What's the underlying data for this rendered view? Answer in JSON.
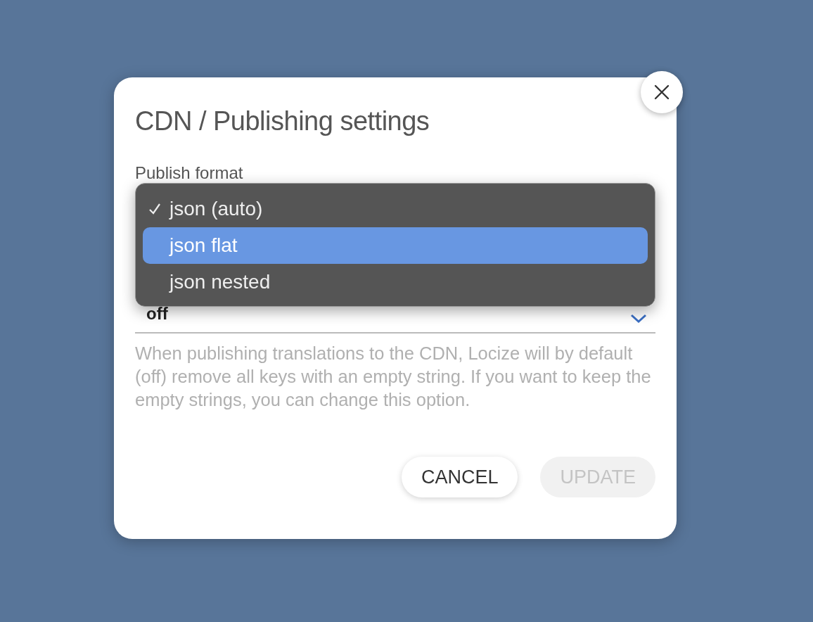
{
  "dialog": {
    "title": "CDN / Publishing settings",
    "publish_format": {
      "label": "Publish format",
      "menu": [
        {
          "label": "json (auto)",
          "checked": true,
          "selected": false
        },
        {
          "label": "json flat",
          "checked": false,
          "selected": true
        },
        {
          "label": "json nested",
          "checked": false,
          "selected": false
        }
      ]
    },
    "empty_strings": {
      "value": "off",
      "help": "When publishing translations to the CDN, Locize will by default (off) remove all keys with an empty string. If you want to keep the empty strings, you can change this option."
    },
    "buttons": [
      {
        "label": "CANCEL",
        "disabled": false
      },
      {
        "label": "UPDATE",
        "disabled": true
      }
    ]
  }
}
